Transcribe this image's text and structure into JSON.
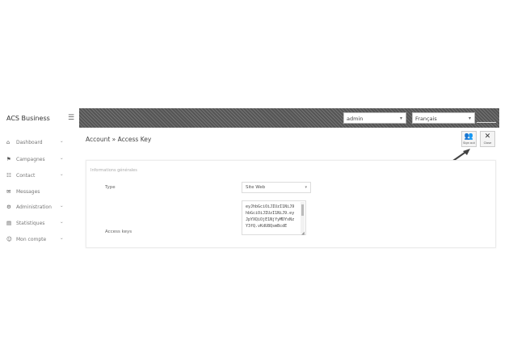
{
  "app": {
    "brand": "ACS Business"
  },
  "header": {
    "user_select": "admin",
    "language_select": "Français"
  },
  "sidebar": {
    "items": [
      {
        "label": "Dashboard",
        "icon": "dashboard-icon",
        "glyph": "⌂"
      },
      {
        "label": "Campagnes",
        "icon": "campaigns-icon",
        "glyph": "⚑"
      },
      {
        "label": "Contact",
        "icon": "contacts-icon",
        "glyph": "☷"
      },
      {
        "label": "Messages",
        "icon": "messages-icon",
        "glyph": "✉"
      },
      {
        "label": "Administration",
        "icon": "admin-icon",
        "glyph": "⚙"
      },
      {
        "label": "Statistiques",
        "icon": "stats-icon",
        "glyph": "▤"
      },
      {
        "label": "Mon compte",
        "icon": "account-icon",
        "glyph": "☺"
      }
    ]
  },
  "page": {
    "title": "Account » Access Key",
    "actions": {
      "signout_label": "Sign out",
      "close_label": "Close"
    }
  },
  "form": {
    "header": "Informations générales",
    "type_label": "Type",
    "type_value": "Site Web",
    "keys_label": "Access keys",
    "keys_lines": [
      "eyJhbGciOiJIUzI1NiJ9",
      "hbGciOiJIUzI1NiJ9.ey",
      "JpYXQiOjE1NjYyMDYxNz",
      "Y3fQ.vKdU8QsmBcdE"
    ]
  },
  "colors": {
    "topbar": "#555555",
    "panel_border": "#ececec"
  }
}
